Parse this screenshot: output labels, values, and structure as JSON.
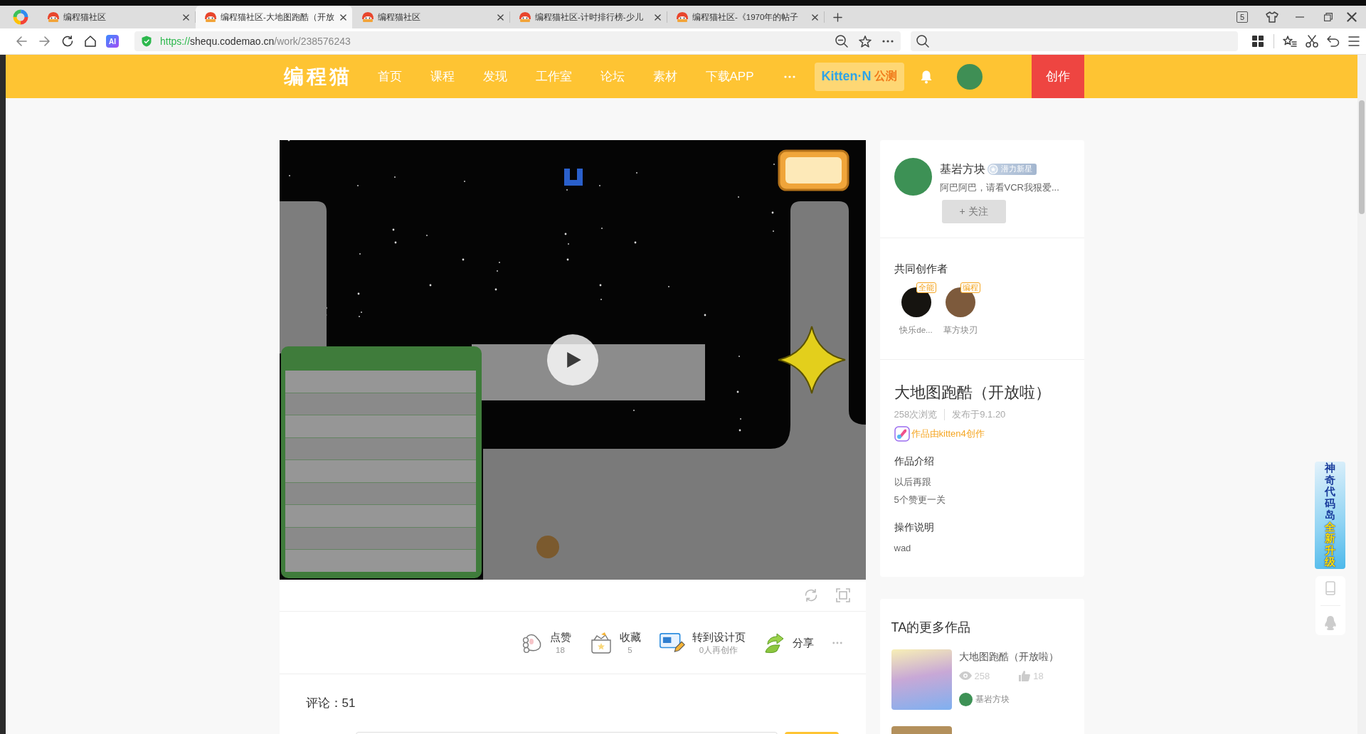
{
  "browser": {
    "tabs": [
      {
        "title": "编程猫社区",
        "selected": false
      },
      {
        "title": "编程猫社区-大地图跑酷（开放",
        "selected": true
      },
      {
        "title": "编程猫社区",
        "selected": false
      },
      {
        "title": "编程猫社区-计时排行榜-少儿",
        "selected": false
      },
      {
        "title": "编程猫社区-《1970年的帖子",
        "selected": false
      }
    ],
    "tab_count": "5",
    "ai_button": "AI",
    "address": {
      "scheme": "https://",
      "host": "shequ.codemao.cn",
      "path": "/work/238576243"
    }
  },
  "nav": {
    "logo": "编程猫",
    "items": [
      "首页",
      "课程",
      "发现",
      "工作室",
      "论坛",
      "素材",
      "下载APP"
    ],
    "promo": {
      "name": "Kitten·N",
      "tag": "公测"
    },
    "create": "创作"
  },
  "actions": [
    {
      "kind": "like",
      "label": "点赞",
      "count": "18"
    },
    {
      "kind": "collect",
      "label": "收藏",
      "count": "5"
    },
    {
      "kind": "remix",
      "label": "转到设计页",
      "count": "0人再创作"
    },
    {
      "kind": "share",
      "label": "分享"
    }
  ],
  "comments": {
    "title": "评论：51"
  },
  "author": {
    "name": "基岩方块",
    "badge": "潜力新星",
    "bio": "阿巴阿巴，请看VCR我狠爱...",
    "follow": "+ 关注"
  },
  "coauthors": {
    "heading": "共同创作者",
    "people": [
      {
        "name": "快乐de...",
        "role": "全能"
      },
      {
        "name": "草方块刃",
        "role": "编程"
      }
    ]
  },
  "work": {
    "title": "大地图跑酷（开放啦）",
    "views": "258次浏览",
    "published": "发布于9.1.20",
    "made_with": "作品由kitten4创作",
    "sections": [
      {
        "heading": "作品介绍",
        "lines": [
          "以后再跟",
          "5个赞更一关"
        ]
      },
      {
        "heading": "操作说明",
        "lines": [
          "wad"
        ]
      }
    ]
  },
  "more_works": {
    "heading": "TA的更多作品",
    "items": [
      {
        "title": "大地图跑酷（开放啦）",
        "views": "258",
        "likes": "18",
        "author": "基岩方块"
      }
    ]
  },
  "side_banner": {
    "title": "神奇代码岛",
    "highlight": "全新升级"
  }
}
